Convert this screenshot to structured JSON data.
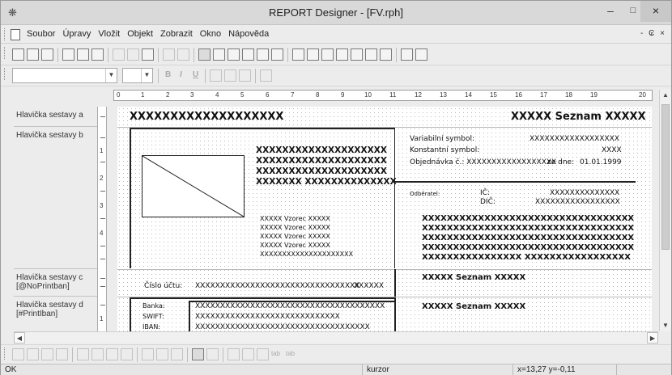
{
  "window": {
    "title": "REPORT Designer - [FV.rph]",
    "minimize_glyph": "–",
    "maximize_glyph": "□",
    "close_glyph": "×"
  },
  "menubar": {
    "items": [
      "Soubor",
      "Úpravy",
      "Vložit",
      "Objekt",
      "Zobrazit",
      "Okno",
      "Nápověda"
    ],
    "mdi_controls": "- ₢ ×"
  },
  "toolbar2": {
    "font_value": "",
    "size_value": "",
    "bold_label": "B",
    "italic_label": "I",
    "underline_label": "U"
  },
  "ruler": {
    "labels": [
      "0",
      "1",
      "2",
      "3",
      "4",
      "5",
      "6",
      "7",
      "8",
      "9",
      "10",
      "11",
      "12",
      "13",
      "14",
      "15",
      "16",
      "17",
      "18",
      "19",
      "20"
    ]
  },
  "bands": [
    {
      "label": "Hlavička sestavy a"
    },
    {
      "label": "Hlavička sestavy b"
    },
    {
      "label": "Hlavička sestavy c [@NoPrintban]"
    },
    {
      "label": "Hlavička sestavy d [#PrintIban]"
    }
  ],
  "vruler": {
    "band_b_numbers": [
      "1",
      "2",
      "3",
      "4"
    ],
    "band_d_numbers": [
      "1"
    ]
  },
  "canvas": {
    "a_left": "XXXXXXXXXXXXXXXXXXX",
    "a_right": "XXXXX Seznam XXXXX",
    "company_lines": [
      "XXXXXXXXXXXXXXXXXXXX",
      "XXXXXXXXXXXXXXXXXXXX",
      "XXXXXXXXXXXXXXXXXXXX",
      "XXXXXXX XXXXXXXXXXXXXX"
    ],
    "vzorec_lines": [
      "XXXXX Vzorec XXXXX",
      "XXXXX Vzorec XXXXX",
      "XXXXX Vzorec XXXXX",
      "XXXXX Vzorec XXXXX",
      "XXXXXXXXXXXXXXXXXXXXX"
    ],
    "var_symbol_label": "Variabilní symbol:",
    "var_symbol_value": "XXXXXXXXXXXXXXXXXX",
    "konst_symbol_label": "Konstantní symbol:",
    "konst_symbol_value": "XXXX",
    "objednavka_label": "Objednávka č.: XXXXXXXXXXXXXXXXXX",
    "ze_dne_label": "ze dne:",
    "ze_dne_value": "01.01.1999",
    "odberatel_label": "Odběratel:",
    "ic_label": "IČ:",
    "dic_label": "DIČ:",
    "ic_value": "XXXXXXXXXXXXXX",
    "dic_value": "XXXXXXXXXXXXXXXXX",
    "odberatel_lines": [
      "XXXXXXXXXXXXXXXXXXXXXXXXXXXXXXXXXX",
      "XXXXXXXXXXXXXXXXXXXXXXXXXXXXXXXXXX",
      "XXXXXXXXXXXXXXXXXXXXXXXXXXXXXXXXXX",
      "XXXXXXXXXXXXXXXXXXXXXXXXXXXXXXXXXX",
      "XXXXXXXXXXXXXXXX XXXXXXXXXXXXXXXXX"
    ],
    "cislo_uctu_label": "Číslo účtu:",
    "cislo_uctu_value": "XXXXXXXXXXXXXXXXXXXXXXXXXXXXXXXXX",
    "cislo_uctu_code": "XXXXXX",
    "c_right": "XXXXX Seznam XXXXX",
    "banka_label": "Banka:",
    "swift_label": "SWIFT:",
    "iban_label": "IBAN:",
    "banka_value": "XXXXXXXXXXXXXXXXXXXXXXXXXXXXXXXXXXXXXX",
    "swift_value": "XXXXXXXXXXXXXXXXXXXXXXXXXXXXX",
    "iban_value": "XXXXXXXXXXXXXXXXXXXXXXXXXXXXXXXXXXX",
    "d_right": "XXXXX Seznam XXXXX"
  },
  "bottom_toolbar": {
    "tab_label_1": "tab",
    "tab_label_2": "tab"
  },
  "statusbar": {
    "status": "OK",
    "mode": "kurzor",
    "coords": "x=13,27  y=-0,11"
  }
}
